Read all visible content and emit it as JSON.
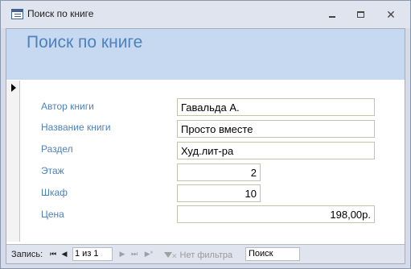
{
  "window": {
    "title": "Поиск по книге",
    "icon": "form-icon",
    "controls": {
      "minimize": "",
      "maximize": "",
      "close": "✕"
    }
  },
  "form": {
    "title": "Поиск по книге",
    "fields": [
      {
        "label": "Автор книги",
        "value": "Гавальда А."
      },
      {
        "label": "Название книги",
        "value": "Просто вместе"
      },
      {
        "label": "Раздел",
        "value": "Худ.лит-ра"
      },
      {
        "label": "Этаж",
        "value": "2"
      },
      {
        "label": "Шкаф",
        "value": "10"
      },
      {
        "label": "Цена",
        "value": "198,00р."
      }
    ]
  },
  "navigation": {
    "record_label": "Запись:",
    "first": "⏮",
    "prev": "◀",
    "next": "▶",
    "last": "⏭",
    "new": "▶*",
    "record_position": "1 из 1",
    "filter_label": "Нет фильтра",
    "search_value": "Поиск"
  },
  "colors": {
    "accent": "#4f81bd",
    "header_background": "#c6d9f1"
  }
}
